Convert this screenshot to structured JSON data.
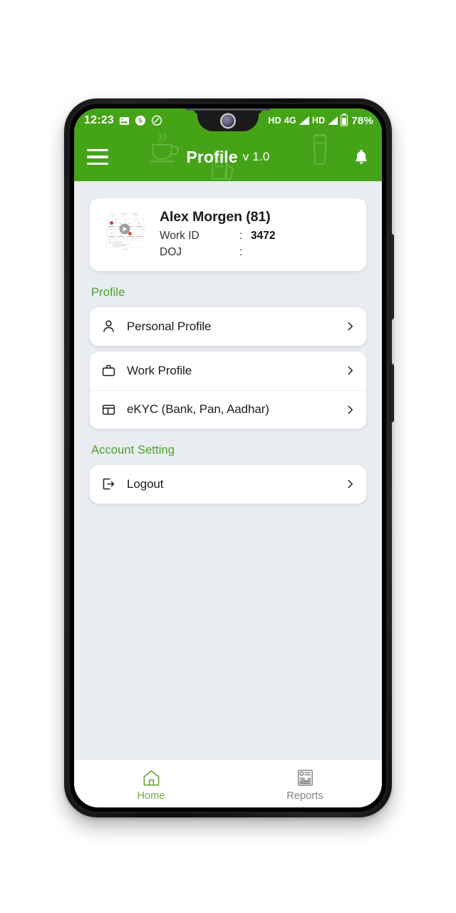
{
  "status_bar": {
    "clock": "12:23",
    "icons_left": [
      "gallery-icon",
      "skype-icon",
      "do-not-disturb-icon"
    ],
    "network_hd_1": "HD",
    "network_type": "4G",
    "network_hd_2": "HD",
    "battery_percent": "78%"
  },
  "header": {
    "title": "Profile",
    "version": "v 1.0",
    "menu_icon": "hamburger-menu-icon",
    "bell_icon": "notification-bell-icon",
    "watermarks": [
      "coffee-cup-icon",
      "glass-icon",
      "milk-carton-icon"
    ],
    "background_color": "#45A318"
  },
  "profile_card": {
    "name": "Alex Morgen (81)",
    "rows": [
      {
        "label": "Work ID",
        "colon": ":",
        "value": "3472"
      },
      {
        "label": "DOJ",
        "colon": ":",
        "value": ""
      }
    ]
  },
  "sections": [
    {
      "label": "Profile",
      "groups": [
        {
          "items": [
            {
              "icon": "person-icon",
              "label": "Personal Profile"
            }
          ]
        },
        {
          "items": [
            {
              "icon": "briefcase-icon",
              "label": "Work Profile"
            },
            {
              "icon": "id-card-icon",
              "label": "eKYC (Bank, Pan, Aadhar)"
            }
          ]
        }
      ]
    },
    {
      "label": "Account Setting",
      "groups": [
        {
          "items": [
            {
              "icon": "logout-icon",
              "label": "Logout"
            }
          ]
        }
      ]
    }
  ],
  "bottom_nav": {
    "items": [
      {
        "icon": "home-icon",
        "label": "Home",
        "active": true
      },
      {
        "icon": "reports-icon",
        "label": "Reports",
        "active": false
      }
    ],
    "active_color": "#6FA844",
    "inactive_color": "#808080"
  },
  "colors": {
    "brand_green": "#45A318",
    "section_green": "#4CA22A",
    "page_background": "#E9ECF1",
    "card_white": "#FFFFFF"
  }
}
